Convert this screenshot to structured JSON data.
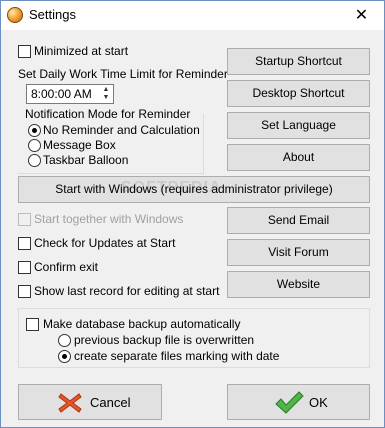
{
  "window": {
    "title": "Settings",
    "close_glyph": "✕",
    "app_icon": "app-orb-icon"
  },
  "options": {
    "minimized_at_start": "Minimized at start",
    "work_time_label": "Set Daily Work Time Limit  for Reminder",
    "work_time_value": "8:00:00 AM",
    "notification_group_title": "Notification Mode for Reminder",
    "notification_modes": [
      "No Reminder and Calculation",
      "Message Box",
      "Taskbar Balloon"
    ],
    "notification_selected": "No Reminder and Calculation",
    "start_together": "Start together with Windows",
    "check_updates": "Check for Updates at Start",
    "confirm_exit": "Confirm exit",
    "show_last_record": "Show last record for editing at start"
  },
  "buttons": {
    "startup_shortcut": "Startup Shortcut",
    "desktop_shortcut": "Desktop Shortcut",
    "set_language": "Set Language",
    "about": "About",
    "start_with_windows": "Start with Windows (requires administrator privilege)",
    "send_email": "Send Email",
    "visit_forum": "Visit Forum",
    "website": "Website",
    "cancel": "Cancel",
    "ok": "OK"
  },
  "backup": {
    "make_backup": "Make database backup automatically",
    "modes": [
      "previous backup file is overwritten",
      "create separate files marking with date"
    ],
    "selected": "create separate files marking with date"
  },
  "watermark": "SOFTPEDIA"
}
